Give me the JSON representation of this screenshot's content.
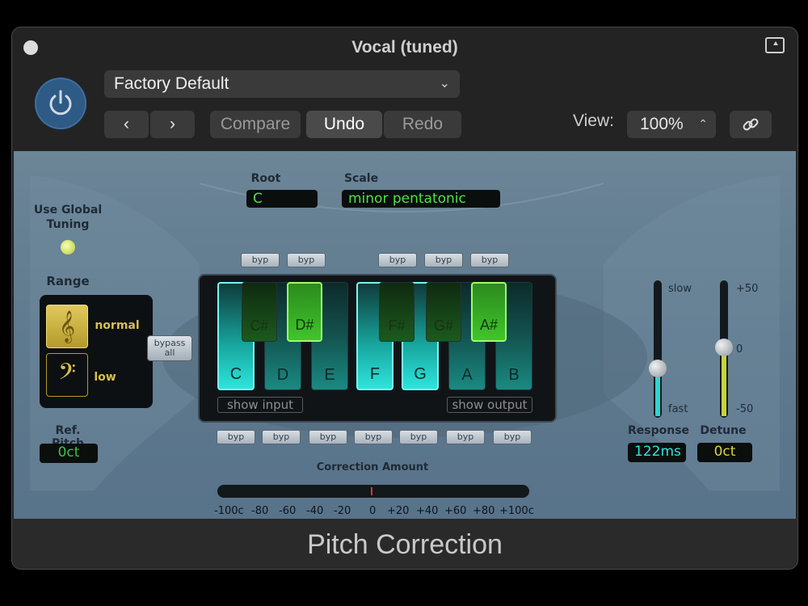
{
  "window": {
    "title": "Vocal (tuned)"
  },
  "header": {
    "preset": "Factory Default",
    "prev_label": "‹",
    "next_label": "›",
    "compare_label": "Compare",
    "undo_label": "Undo",
    "redo_label": "Redo",
    "view_label": "View:",
    "zoom": "100%"
  },
  "plugin": {
    "name": "Pitch Correction",
    "use_global_tuning_line1": "Use Global",
    "use_global_tuning_line2": "Tuning",
    "range_label": "Range",
    "range_normal": "normal",
    "range_low": "low",
    "ref_pitch_label": "Ref. Pitch",
    "ref_pitch_value": "0ct",
    "root_label": "Root",
    "root_value": "C",
    "scale_label": "Scale",
    "scale_value": "minor pentatonic",
    "byp_label": "byp",
    "bypass_all_line1": "bypass",
    "bypass_all_line2": "all",
    "white_keys": [
      "C",
      "D",
      "E",
      "F",
      "G",
      "A",
      "B"
    ],
    "black_keys": [
      "C#",
      "D#",
      "F#",
      "G#",
      "A#"
    ],
    "show_input": "show input",
    "show_output": "show output",
    "correction_amount_label": "Correction Amount",
    "meter_ticks": [
      "-100c",
      "-80",
      "-60",
      "-40",
      "-20",
      "0",
      "+20",
      "+40",
      "+60",
      "+80",
      "+100c"
    ],
    "response_label": "Response",
    "response_slow": "slow",
    "response_fast": "fast",
    "response_value": "122ms",
    "detune_label": "Detune",
    "detune_top": "+50",
    "detune_mid": "0",
    "detune_bottom": "-50",
    "detune_value": "0ct"
  },
  "colors": {
    "lcd_green": "#4ee14a",
    "key_active_cyan": "#2ee5dc",
    "key_active_green": "#40c52b",
    "power_blue": "#2e5a86",
    "panel_blue_gray": "#6c8597"
  }
}
